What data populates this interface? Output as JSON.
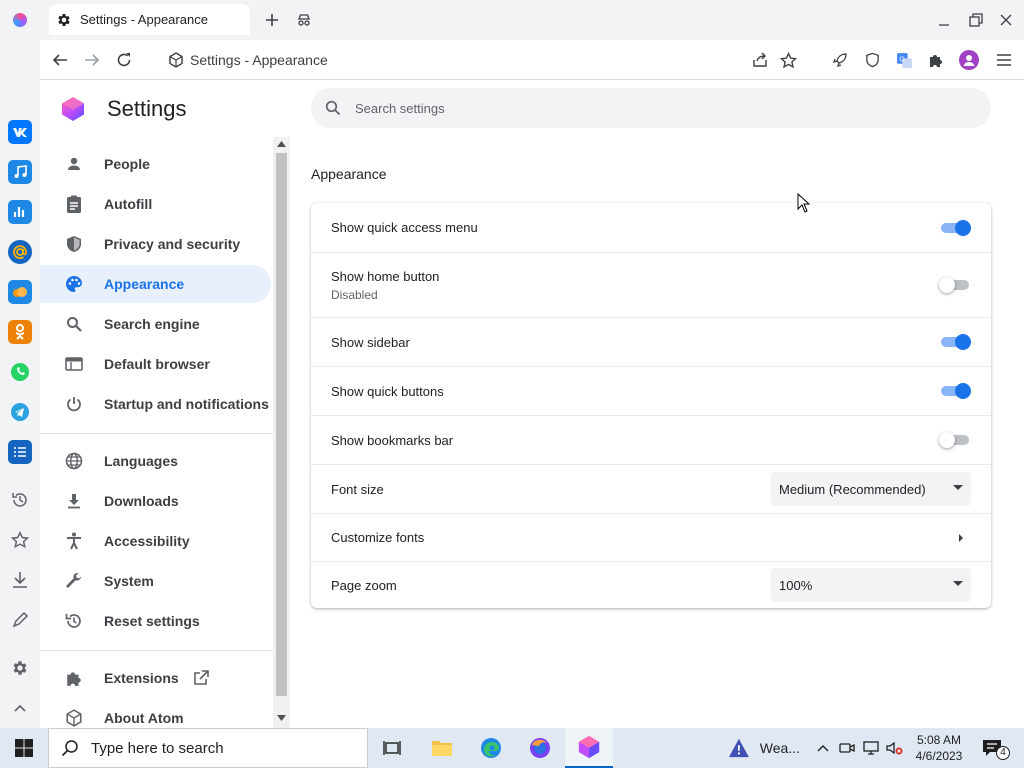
{
  "browser": {
    "tab_title": "Settings - Appearance",
    "url_text": "Settings - Appearance"
  },
  "settings": {
    "title": "Settings",
    "search_placeholder": "Search settings",
    "nav": [
      {
        "label": "People",
        "icon": "person-icon"
      },
      {
        "label": "Autofill",
        "icon": "clipboard-icon"
      },
      {
        "label": "Privacy and security",
        "icon": "shield-icon"
      },
      {
        "label": "Appearance",
        "icon": "palette-icon",
        "active": true
      },
      {
        "label": "Search engine",
        "icon": "search-icon"
      },
      {
        "label": "Default browser",
        "icon": "browser-icon"
      },
      {
        "label": "Startup and notifications",
        "icon": "power-icon"
      },
      {
        "label": "Languages",
        "icon": "globe-icon"
      },
      {
        "label": "Downloads",
        "icon": "download-icon"
      },
      {
        "label": "Accessibility",
        "icon": "accessibility-icon"
      },
      {
        "label": "System",
        "icon": "wrench-icon"
      },
      {
        "label": "Reset settings",
        "icon": "reset-icon"
      },
      {
        "label": "Extensions",
        "icon": "puzzle-icon"
      },
      {
        "label": "About Atom",
        "icon": "atom-icon"
      }
    ],
    "section_title": "Appearance",
    "rows": [
      {
        "label": "Show quick access menu",
        "control": "toggle",
        "on": true
      },
      {
        "label": "Show home button",
        "sublabel": "Disabled",
        "control": "toggle",
        "on": false
      },
      {
        "label": "Show sidebar",
        "control": "toggle",
        "on": true
      },
      {
        "label": "Show quick buttons",
        "control": "toggle",
        "on": true
      },
      {
        "label": "Show bookmarks bar",
        "control": "toggle",
        "on": false
      },
      {
        "label": "Font size",
        "control": "select",
        "value": "Medium (Recommended)"
      },
      {
        "label": "Customize fonts",
        "control": "arrow"
      },
      {
        "label": "Page zoom",
        "control": "select",
        "value": "100%"
      }
    ]
  },
  "taskbar": {
    "search_text": "Type here to search",
    "weather_text": "Wea...",
    "time": "5:08 AM",
    "date": "4/6/2023",
    "notification_count": "4"
  },
  "colors": {
    "accent": "#1a73e8",
    "active_nav_bg": "#e8f0fe"
  }
}
